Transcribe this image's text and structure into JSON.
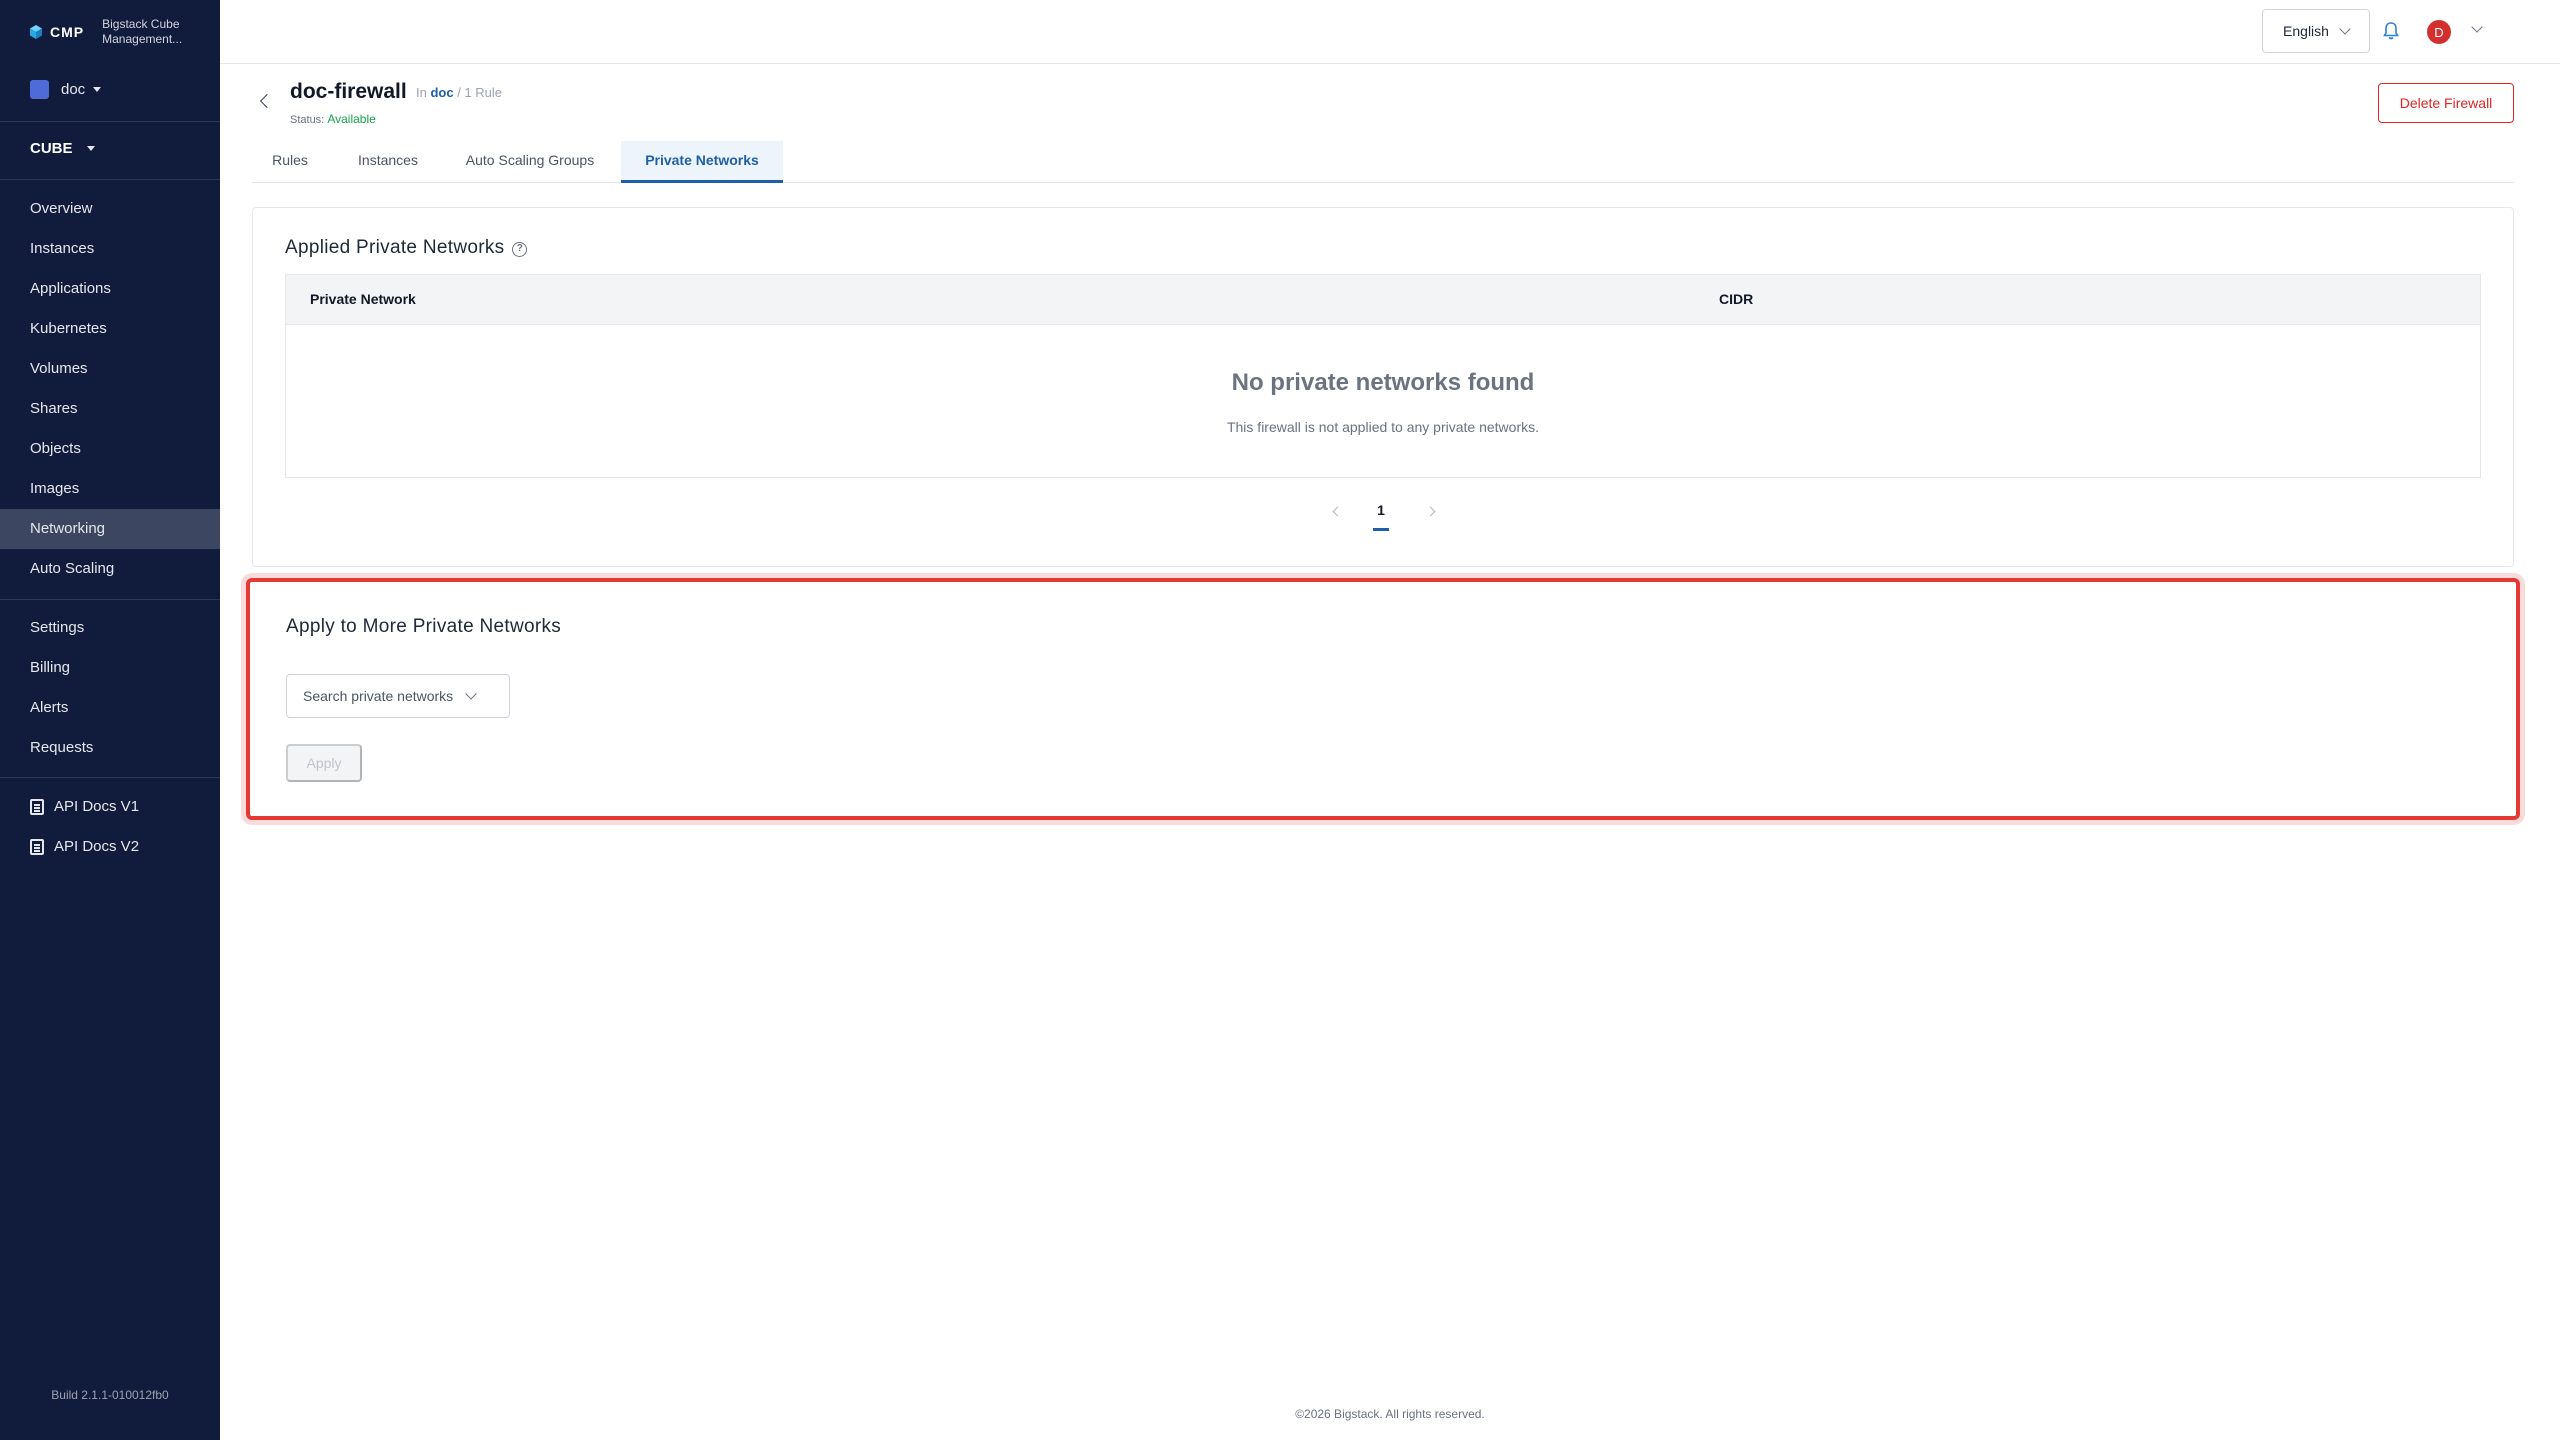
{
  "brand": {
    "short": "CMP",
    "app_name": "Bigstack Cube Management..."
  },
  "sidebar": {
    "project": "doc",
    "product": "CUBE",
    "items": [
      {
        "label": "Overview"
      },
      {
        "label": "Instances"
      },
      {
        "label": "Applications"
      },
      {
        "label": "Kubernetes"
      },
      {
        "label": "Volumes"
      },
      {
        "label": "Shares"
      },
      {
        "label": "Objects"
      },
      {
        "label": "Images"
      },
      {
        "label": "Networking",
        "active": true
      },
      {
        "label": "Auto Scaling"
      }
    ],
    "secondary": [
      {
        "label": "Settings"
      },
      {
        "label": "Billing"
      },
      {
        "label": "Alerts"
      },
      {
        "label": "Requests"
      }
    ],
    "docs": [
      {
        "label": "API Docs V1"
      },
      {
        "label": "API Docs V2"
      }
    ],
    "build": "Build 2.1.1-010012fb0"
  },
  "topbar": {
    "language": "English",
    "avatar_initial": "D"
  },
  "firewall": {
    "name": "doc-firewall",
    "in_prefix": "In",
    "project_link": "doc",
    "rule_count": "/ 1 Rule",
    "status_label": "Status:",
    "status_value": "Available",
    "delete_label": "Delete Firewall"
  },
  "tabs": [
    {
      "label": "Rules"
    },
    {
      "label": "Instances"
    },
    {
      "label": "Auto Scaling Groups"
    },
    {
      "label": "Private Networks",
      "active": true
    }
  ],
  "applied": {
    "title": "Applied Private Networks",
    "columns": [
      "Private Network",
      "CIDR"
    ],
    "empty_title": "No private networks found",
    "empty_subtitle": "This firewall is not applied to any private networks.",
    "page": "1"
  },
  "apply_more": {
    "title": "Apply to More Private Networks",
    "search_placeholder": "Search private networks",
    "apply_label": "Apply"
  },
  "footer": "©2026 Bigstack. All rights reserved.",
  "colors": {
    "sidebar_bg": "#111c3d",
    "accent": "#1e5fa8",
    "danger": "#dc2626",
    "success": "#16a34a"
  }
}
